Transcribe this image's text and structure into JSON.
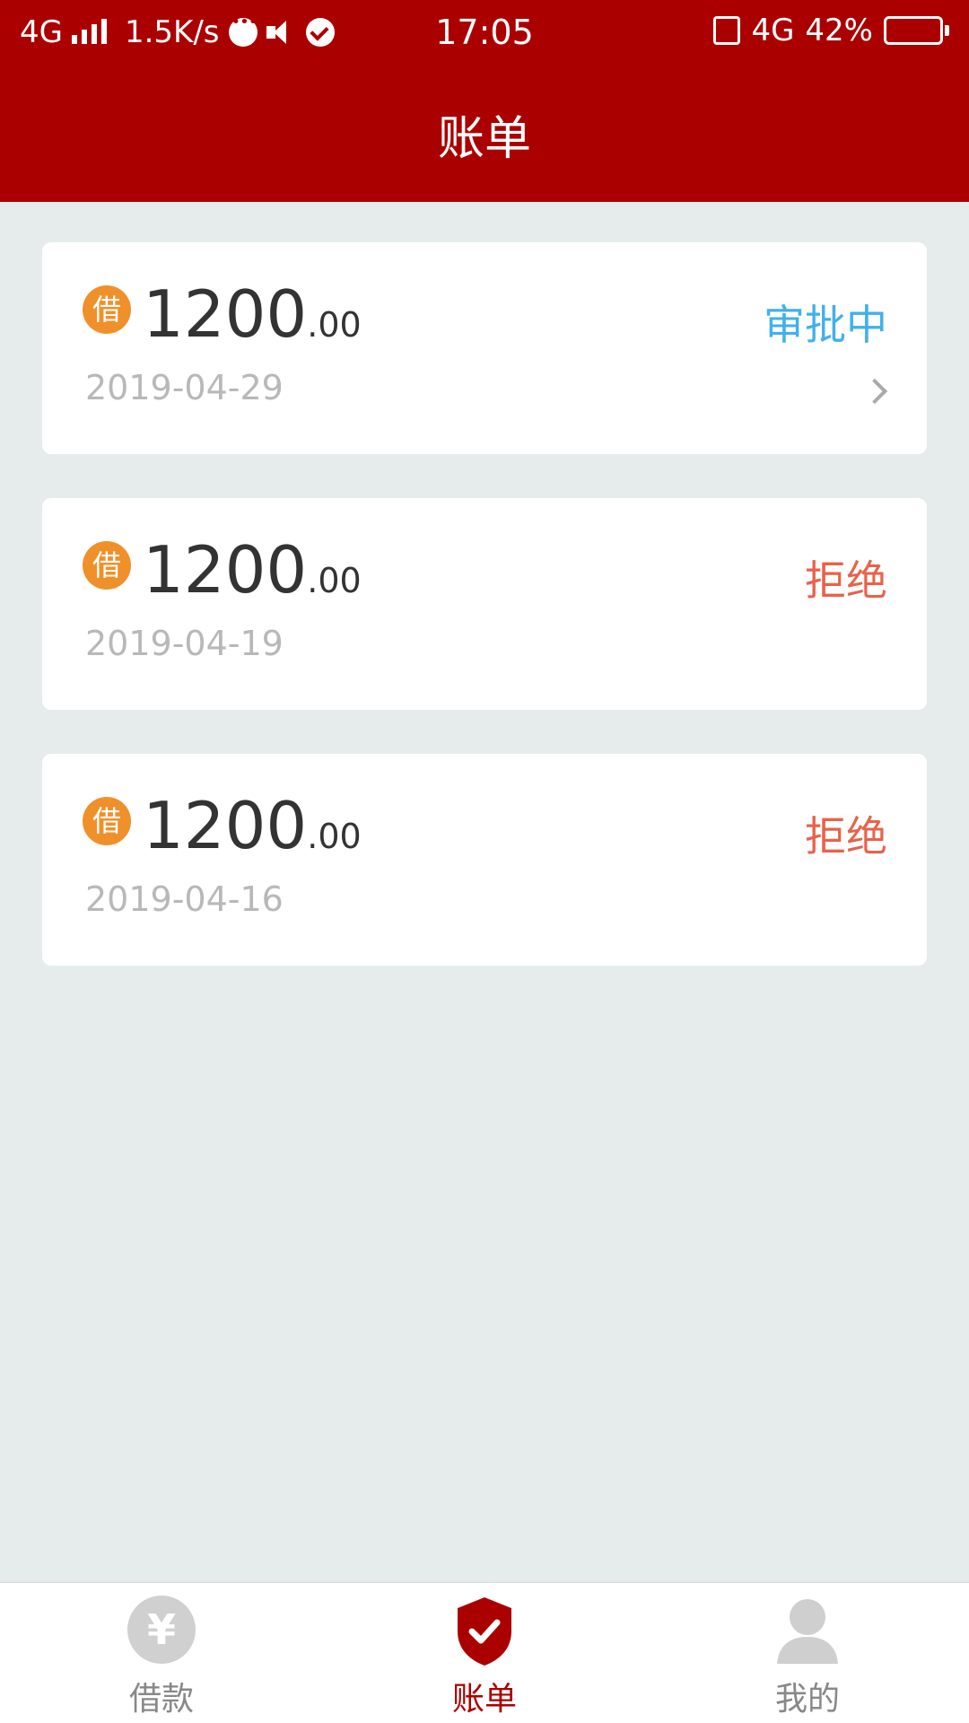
{
  "status_bar": {
    "network_left": "4G",
    "speed": "1.5K/s",
    "time": "17:05",
    "network_right": "4G",
    "battery": "42%",
    "battery_level": 0.42
  },
  "header": {
    "title": "账单"
  },
  "bills": [
    {
      "icon_char": "借",
      "amount_int": "1200",
      "amount_dec": ".00",
      "date": "2019-04-29",
      "status": "审批中",
      "status_type": "pending",
      "has_arrow": true
    },
    {
      "icon_char": "借",
      "amount_int": "1200",
      "amount_dec": ".00",
      "date": "2019-04-19",
      "status": "拒绝",
      "status_type": "rejected",
      "has_arrow": false
    },
    {
      "icon_char": "借",
      "amount_int": "1200",
      "amount_dec": ".00",
      "date": "2019-04-16",
      "status": "拒绝",
      "status_type": "rejected",
      "has_arrow": false
    }
  ],
  "tabbar": {
    "items": [
      {
        "label": "借款",
        "icon": "yen-icon",
        "active": false
      },
      {
        "label": "账单",
        "icon": "shield-check-icon",
        "active": true
      },
      {
        "label": "我的",
        "icon": "user-icon",
        "active": false
      }
    ]
  },
  "colors": {
    "header_bg": "#ab0000",
    "page_bg": "#e6ecec",
    "pending": "#42b0e8",
    "rejected": "#e8624a",
    "loan_badge": "#f0902a"
  }
}
